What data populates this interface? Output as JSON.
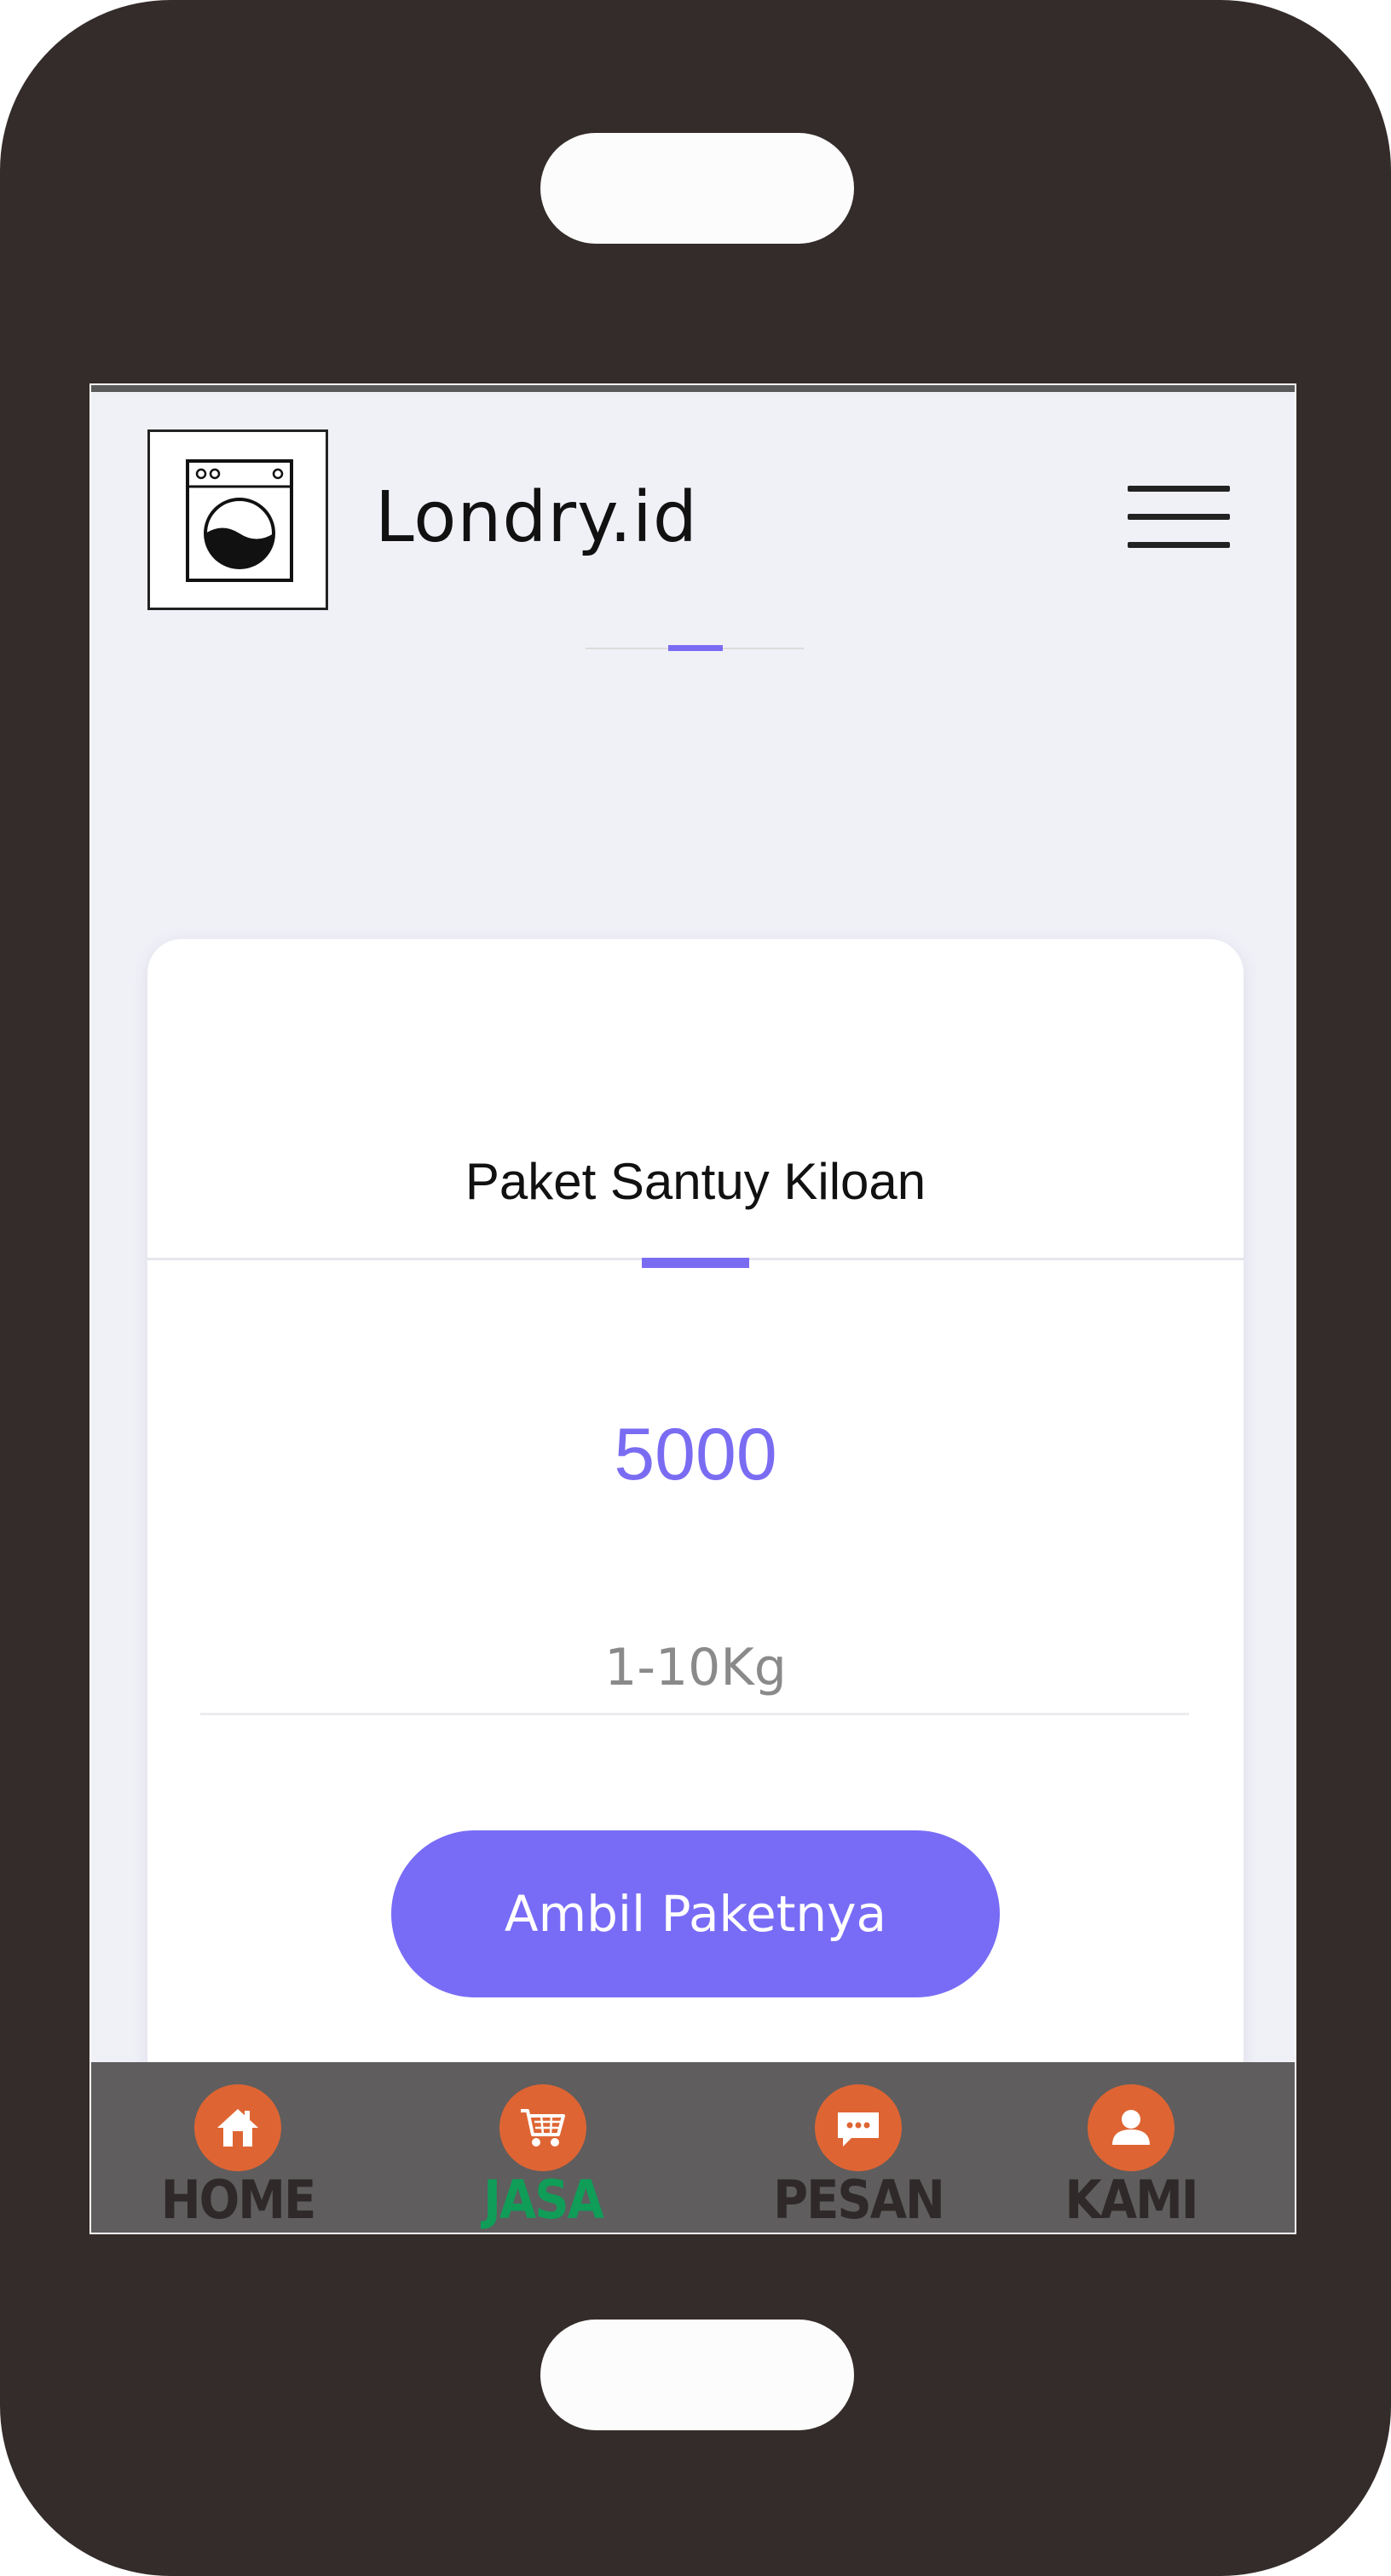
{
  "header": {
    "brand": "Londry.id",
    "logo_icon": "washing-machine-icon",
    "menu_icon": "hamburger-menu-icon"
  },
  "card": {
    "title": "Paket Santuy Kiloan",
    "price": "5000",
    "weight": "1-10Kg",
    "cta_label": "Ambil Paketnya"
  },
  "bottom_nav": {
    "items": [
      {
        "label": "HOME",
        "icon": "home-icon",
        "active": false
      },
      {
        "label": "JASA",
        "icon": "cart-icon",
        "active": true
      },
      {
        "label": "PESAN",
        "icon": "chat-icon",
        "active": false
      },
      {
        "label": "KAMI",
        "icon": "user-icon",
        "active": false
      }
    ]
  },
  "colors": {
    "accent": "#7a6cf2",
    "nav_icon_bg": "#de6533",
    "active_label": "#0f9d58",
    "phone_body": "#342c2a"
  }
}
